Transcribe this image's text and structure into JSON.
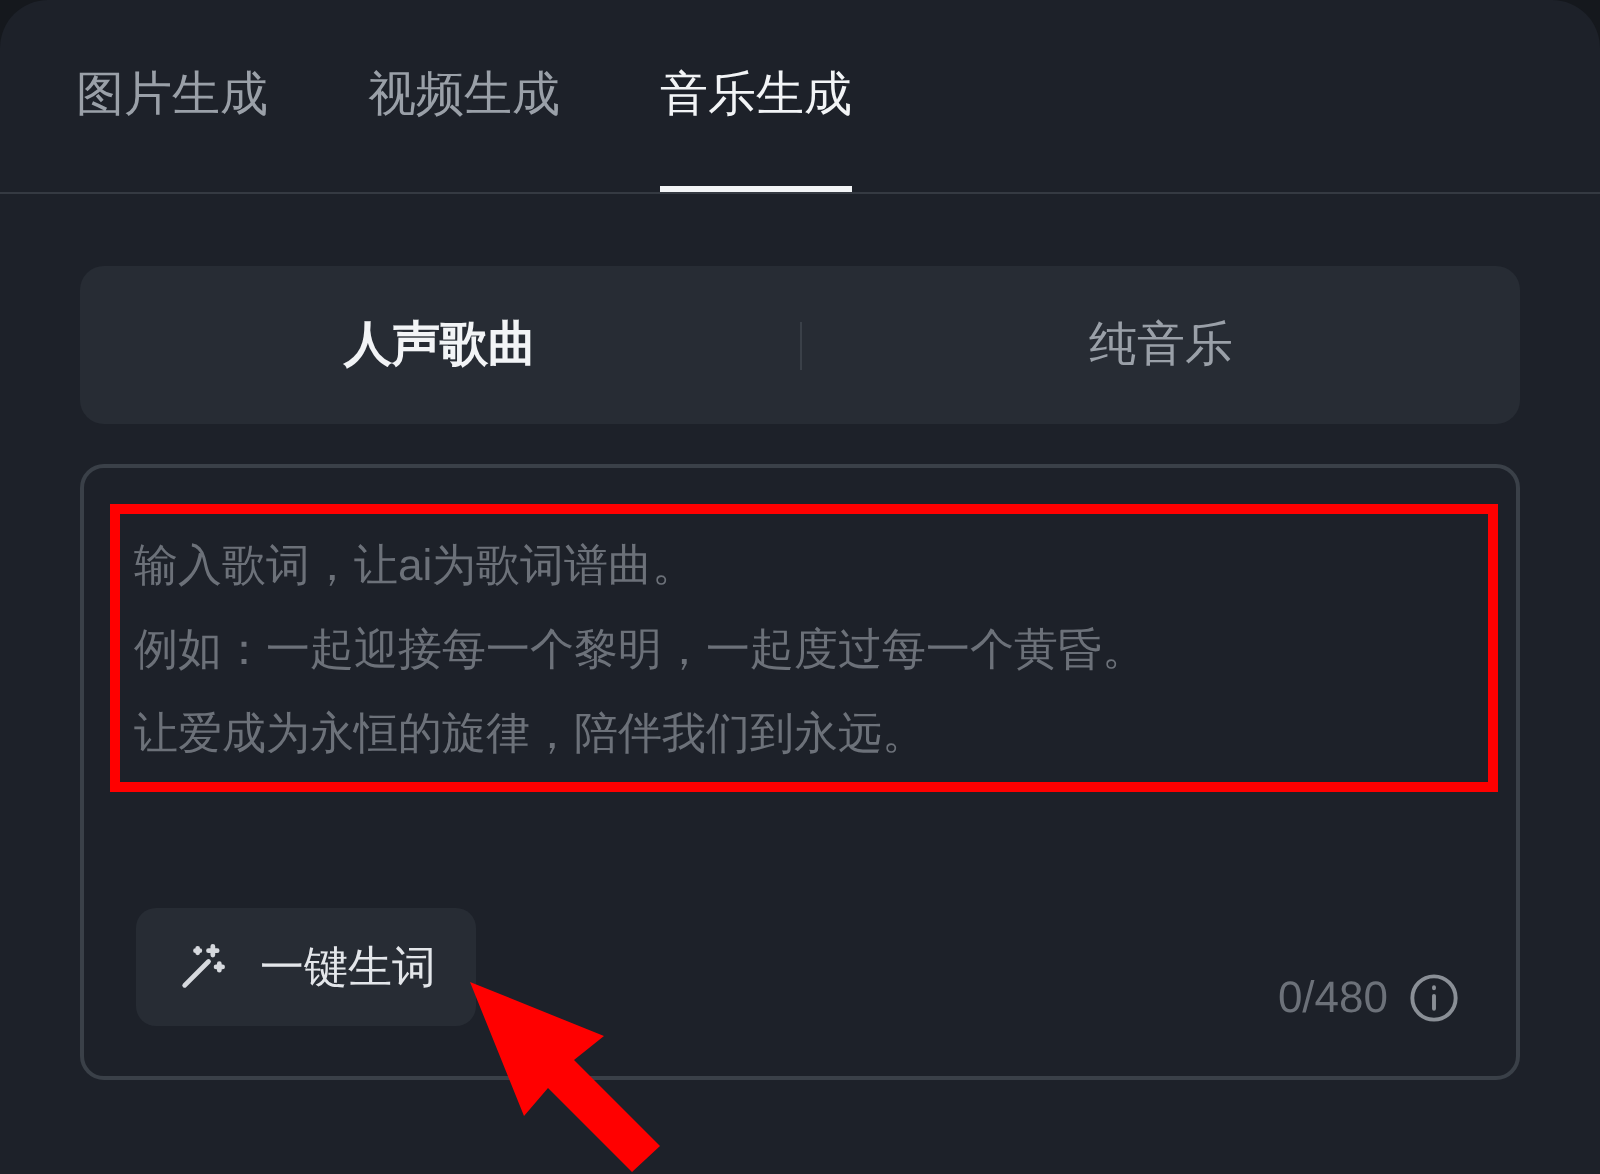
{
  "tabs": [
    {
      "label": "图片生成",
      "selected": false
    },
    {
      "label": "视频生成",
      "selected": false
    },
    {
      "label": "音乐生成",
      "selected": true
    }
  ],
  "modes": [
    {
      "label": "人声歌曲",
      "selected": true
    },
    {
      "label": "纯音乐",
      "selected": false
    }
  ],
  "lyrics_field": {
    "placeholder_lines": [
      "输入歌词，让ai为歌词谱曲。",
      "例如：一起迎接每一个黎明，一起度过每一个黄昏。",
      "让爱成为永恒的旋律，陪伴我们到永远。"
    ]
  },
  "generate_button": {
    "label": "一键生词"
  },
  "char_count": "0/480",
  "annotations": {
    "highlight_box": true,
    "pointer_arrow": true
  }
}
